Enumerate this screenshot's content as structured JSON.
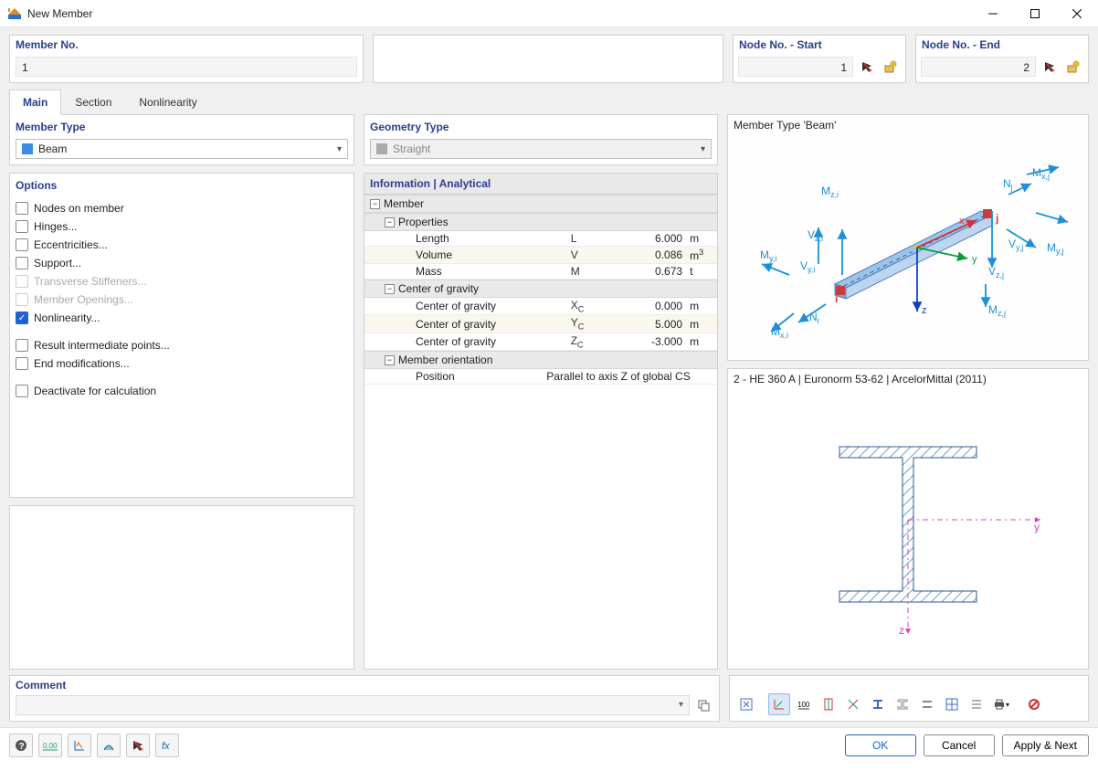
{
  "window": {
    "title": "New Member"
  },
  "header": {
    "member_no": {
      "label": "Member No.",
      "value": "1"
    },
    "node_start": {
      "label": "Node No. - Start",
      "value": "1"
    },
    "node_end": {
      "label": "Node No. - End",
      "value": "2"
    }
  },
  "tabs": {
    "main": {
      "label": "Main"
    },
    "section": {
      "label": "Section"
    },
    "nonlinearity": {
      "label": "Nonlinearity"
    }
  },
  "left": {
    "member_type": {
      "label": "Member Type",
      "value": "Beam"
    },
    "geometry_type": {
      "label": "Geometry Type",
      "value": "Straight"
    },
    "options_label": "Options",
    "options": [
      {
        "id": "nodes-on-member",
        "label": "Nodes on member",
        "checked": false,
        "disabled": false
      },
      {
        "id": "hinges",
        "label": "Hinges...",
        "checked": false,
        "disabled": false
      },
      {
        "id": "eccentricities",
        "label": "Eccentricities...",
        "checked": false,
        "disabled": false
      },
      {
        "id": "support",
        "label": "Support...",
        "checked": false,
        "disabled": false
      },
      {
        "id": "transverse",
        "label": "Transverse Stiffeners...",
        "checked": false,
        "disabled": true
      },
      {
        "id": "member-openings",
        "label": "Member Openings...",
        "checked": false,
        "disabled": true
      },
      {
        "id": "nonlinearity",
        "label": "Nonlinearity...",
        "checked": true,
        "disabled": false
      },
      {
        "id": "result-intermediate",
        "label": "Result intermediate points...",
        "checked": false,
        "disabled": false
      },
      {
        "id": "end-modifications",
        "label": "End modifications...",
        "checked": false,
        "disabled": false
      },
      {
        "id": "deactivate",
        "label": "Deactivate for calculation",
        "checked": false,
        "disabled": false
      }
    ]
  },
  "info": {
    "header": "Information | Analytical",
    "member_label": "Member",
    "properties_label": "Properties",
    "properties": [
      {
        "name": "Length",
        "sym": "L",
        "val": "6.000",
        "unit": "m"
      },
      {
        "name": "Volume",
        "sym": "V",
        "val": "0.086",
        "unit_html": "m<sup>3</sup>"
      },
      {
        "name": "Mass",
        "sym": "M",
        "val": "0.673",
        "unit": "t"
      }
    ],
    "cog_label": "Center of gravity",
    "cog": [
      {
        "name": "Center of gravity",
        "sym_html": "X<sub>C</sub>",
        "val": "0.000",
        "unit": "m"
      },
      {
        "name": "Center of gravity",
        "sym_html": "Y<sub>C</sub>",
        "val": "5.000",
        "unit": "m"
      },
      {
        "name": "Center of gravity",
        "sym_html": "Z<sub>C</sub>",
        "val": "-3.000",
        "unit": "m"
      }
    ],
    "orientation_label": "Member orientation",
    "orientation_row": {
      "name": "Position",
      "val": "Parallel to axis Z of global CS"
    }
  },
  "preview": {
    "title": "Member Type 'Beam'",
    "section_title": "2 - HE 360 A | Euronorm 53-62 | ArcelorMittal (2011)"
  },
  "comment": {
    "label": "Comment",
    "value": ""
  },
  "footer": {
    "ok": "OK",
    "cancel": "Cancel",
    "apply_next": "Apply & Next"
  }
}
